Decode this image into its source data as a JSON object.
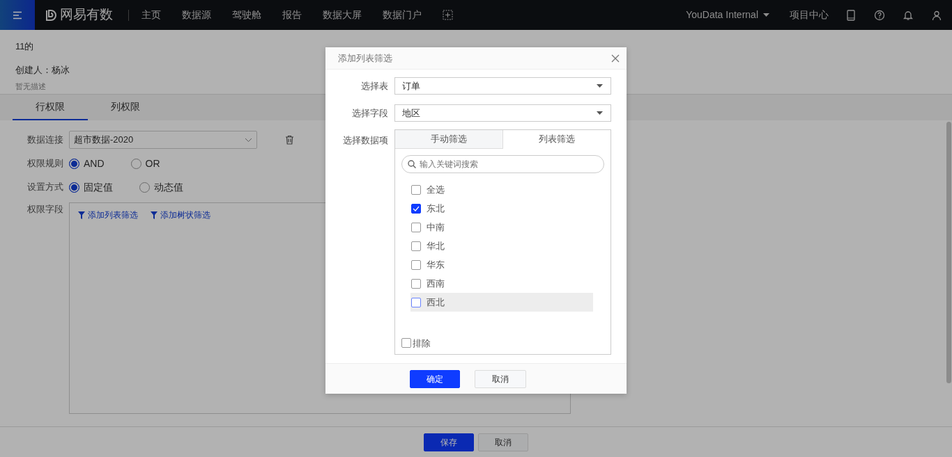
{
  "navbar": {
    "brand": "网易有数",
    "items": [
      {
        "label": "主页"
      },
      {
        "label": "数据源"
      },
      {
        "label": "驾驶舱"
      },
      {
        "label": "报告"
      },
      {
        "label": "数据大屏"
      },
      {
        "label": "数据门户"
      }
    ],
    "account": "YouData Internal",
    "project_center": "项目中心"
  },
  "page": {
    "title": "11的",
    "creator": "创建人：杨冰",
    "description": "暂无描述",
    "tabs": [
      {
        "label": "行权限",
        "selected": true
      },
      {
        "label": "列权限",
        "selected": false
      }
    ],
    "connection": {
      "label": "数据连接",
      "value": "超市数据-2020"
    },
    "rule": {
      "label": "权限规则",
      "options": [
        {
          "label": "AND",
          "selected": true
        },
        {
          "label": "OR",
          "selected": false
        }
      ]
    },
    "mode": {
      "label": "设置方式",
      "options": [
        {
          "label": "固定值",
          "selected": true
        },
        {
          "label": "动态值",
          "selected": false
        }
      ]
    },
    "fields": {
      "label": "权限字段",
      "actions": [
        {
          "label": "添加列表筛选"
        },
        {
          "label": "添加树状筛选"
        }
      ]
    },
    "buttons": [
      {
        "label": "保存",
        "kind": "primary"
      },
      {
        "label": "取消",
        "kind": "secondary"
      }
    ]
  },
  "modal": {
    "title": "添加列表筛选",
    "table_select": {
      "label": "选择表",
      "value": "订单"
    },
    "field_select": {
      "label": "选择字段",
      "value": "地区"
    },
    "items": {
      "label": "选择数据项",
      "tabs": [
        {
          "label": "手动筛选",
          "selected": false
        },
        {
          "label": "列表筛选",
          "selected": true
        }
      ],
      "search": {
        "placeholder": "输入关键词搜索"
      },
      "options": [
        {
          "label": "全选",
          "checked": false,
          "highlighted": false
        },
        {
          "label": "东北",
          "checked": true,
          "highlighted": false
        },
        {
          "label": "中南",
          "checked": false,
          "highlighted": false
        },
        {
          "label": "华北",
          "checked": false,
          "highlighted": false
        },
        {
          "label": "华东",
          "checked": false,
          "highlighted": false
        },
        {
          "label": "西南",
          "checked": false,
          "highlighted": false
        },
        {
          "label": "西北",
          "checked": false,
          "highlighted": true
        }
      ],
      "exclude": {
        "label": "排除",
        "checked": false
      }
    },
    "buttons": [
      {
        "label": "确定",
        "kind": "primary"
      },
      {
        "label": "取消",
        "kind": "secondary"
      }
    ]
  }
}
